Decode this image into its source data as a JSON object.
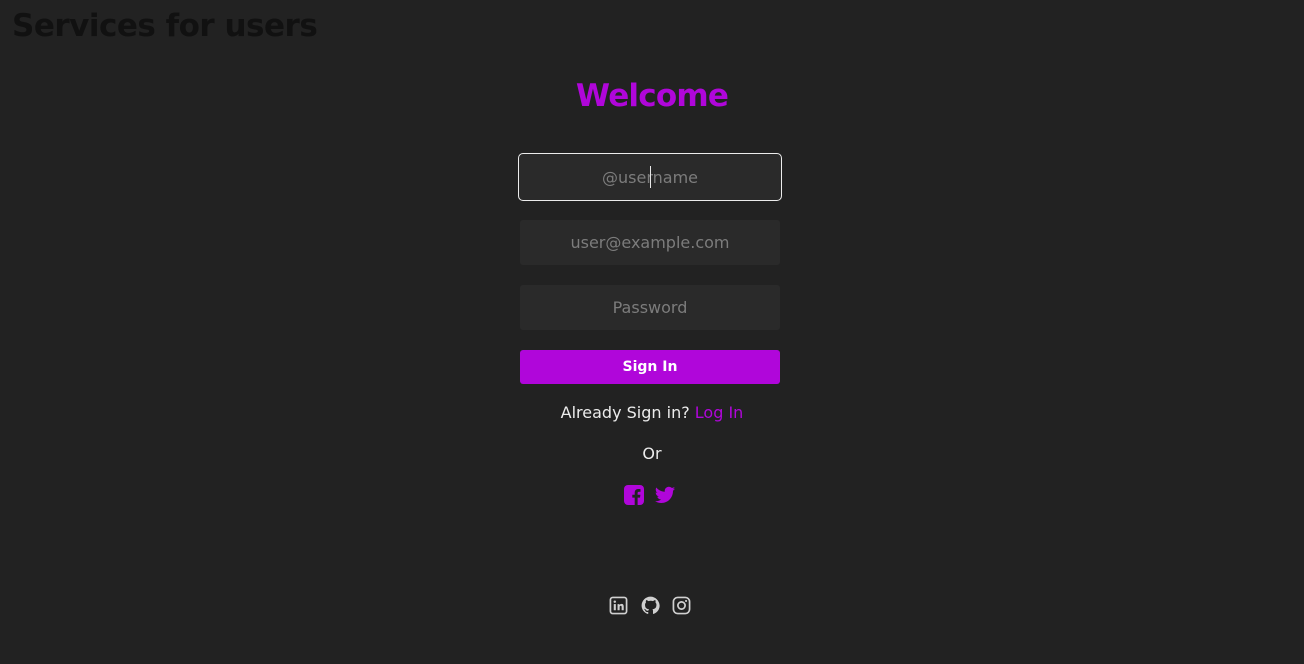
{
  "header": {
    "title": "Services for users"
  },
  "form": {
    "heading": "Welcome",
    "username_placeholder": "@username",
    "email_placeholder": "user@example.com",
    "password_placeholder": "Password",
    "submit_label": "Sign In",
    "already_text": "Already Sign in?",
    "login_link": "Log In",
    "or_text": "Or"
  },
  "social_login": [
    {
      "icon": "facebook-icon"
    },
    {
      "icon": "twitter-icon"
    }
  ],
  "footer": {
    "icons": [
      "linkedin-icon",
      "github-icon",
      "instagram-icon"
    ]
  },
  "colors": {
    "background": "#222222",
    "accent": "#b006da",
    "field_background": "#2a2a2a",
    "text": "#ececec",
    "footer_icon": "#d0d0d0"
  }
}
